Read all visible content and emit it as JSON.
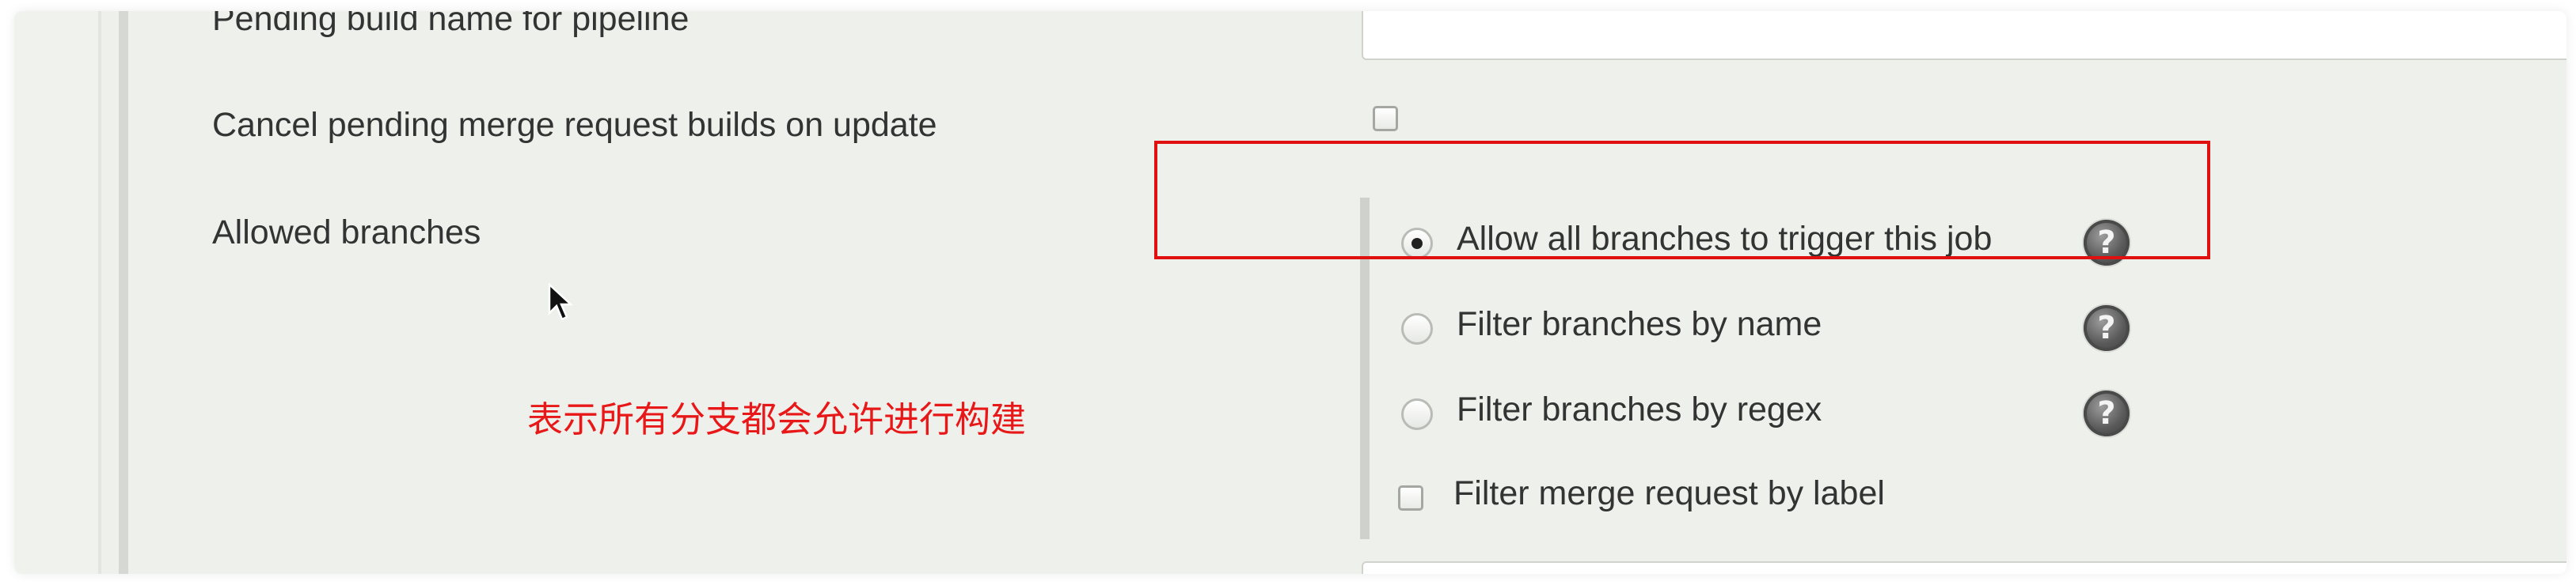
{
  "form": {
    "pipeline_field_label": "Pending build name for pipeline",
    "pipeline_field_value": "",
    "cancel_pending_label": "Cancel pending merge request builds on update",
    "cancel_pending_checked": false,
    "allowed_branches_label": "Allowed branches"
  },
  "branch_options": [
    {
      "label": "Allow all branches to trigger this job",
      "selected": true,
      "help_icon": "question-mark-icon"
    },
    {
      "label": "Filter branches by name",
      "selected": false,
      "help_icon": "question-mark-icon"
    },
    {
      "label": "Filter branches by regex",
      "selected": false,
      "help_icon": "question-mark-icon"
    }
  ],
  "filter_by_label": {
    "label": "Filter merge request by label",
    "checked": false
  },
  "help_glyph": "?",
  "annotation": {
    "text": "表示所有分支都会允许进行构建",
    "color": "#e81818",
    "box_color": "#e01010"
  }
}
